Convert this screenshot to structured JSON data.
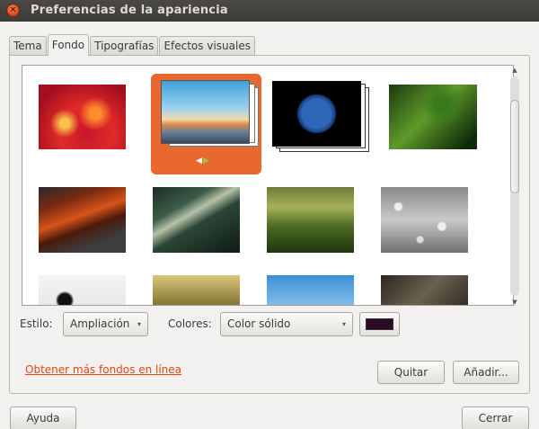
{
  "window": {
    "title": "Preferencias de la apariencia",
    "close_glyph": "×"
  },
  "tabs": [
    {
      "label": "Tema",
      "active": false
    },
    {
      "label": "Fondo",
      "active": true
    },
    {
      "label": "Tipografías",
      "active": false
    },
    {
      "label": "Efectos visuales",
      "active": false
    }
  ],
  "wallpapers": [
    {
      "name": "red-droplets",
      "selected": false
    },
    {
      "name": "sky-sunset",
      "selected": true
    },
    {
      "name": "earth",
      "selected": false
    },
    {
      "name": "green-leaf",
      "selected": false
    },
    {
      "name": "orange-feather",
      "selected": false
    },
    {
      "name": "palm-frond",
      "selected": false
    },
    {
      "name": "grass",
      "selected": false
    },
    {
      "name": "water-drops",
      "selected": false
    },
    {
      "name": "bird",
      "selected": false
    },
    {
      "name": "dandelions",
      "selected": false
    },
    {
      "name": "blue-sky",
      "selected": false
    },
    {
      "name": "rope",
      "selected": false
    }
  ],
  "selection_arrows": {
    "left": "◀",
    "right": "▶"
  },
  "controls": {
    "style_label": "Estilo:",
    "style_value": "Ampliación",
    "colors_label": "Colores:",
    "colors_value": "Color sólido",
    "color_swatch": "#2a0a24"
  },
  "link_text": "Obtener más fondos en línea",
  "buttons": {
    "remove": "Quitar",
    "add": "Añadir...",
    "help": "Ayuda",
    "close": "Cerrar"
  },
  "scroll": {
    "up": "▲",
    "down": "▼",
    "thumb_glyph": "⁞"
  },
  "caret": "▾",
  "accent": "#e8682f"
}
